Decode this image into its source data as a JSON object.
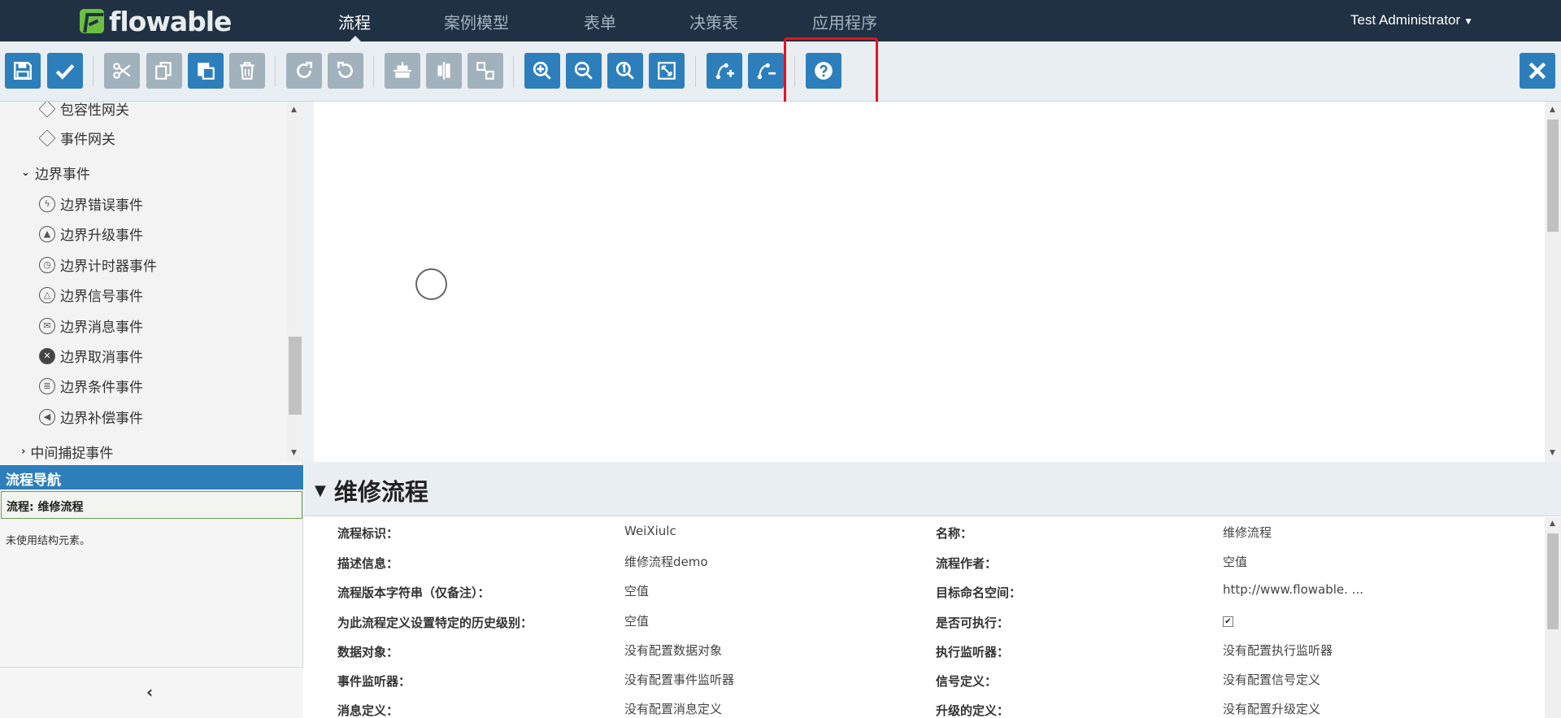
{
  "brand": {
    "logo_text": "flowable"
  },
  "nav": {
    "tabs": [
      {
        "label": "流程",
        "active": true
      },
      {
        "label": "案例模型",
        "active": false
      },
      {
        "label": "表单",
        "active": false
      },
      {
        "label": "决策表",
        "active": false
      },
      {
        "label": "应用程序",
        "active": false
      }
    ],
    "user": "Test Administrator"
  },
  "toolbar": {
    "buttons": [
      {
        "name": "save",
        "icon": "floppy-disk-icon",
        "enabled": true
      },
      {
        "name": "validate",
        "icon": "checkmark-icon",
        "enabled": true
      },
      {
        "name": "cut",
        "icon": "scissors-icon",
        "enabled": false
      },
      {
        "name": "copy",
        "icon": "copy-icon",
        "enabled": false
      },
      {
        "name": "paste",
        "icon": "paste-icon",
        "enabled": true
      },
      {
        "name": "delete",
        "icon": "trash-icon",
        "enabled": false
      },
      {
        "name": "redo",
        "icon": "redo-icon",
        "enabled": false
      },
      {
        "name": "undo",
        "icon": "undo-icon",
        "enabled": false
      },
      {
        "name": "align-horizontal",
        "icon": "align-horizontal-icon",
        "enabled": false
      },
      {
        "name": "align-vertical",
        "icon": "align-vertical-icon",
        "enabled": false
      },
      {
        "name": "same-size",
        "icon": "same-size-icon",
        "enabled": false
      },
      {
        "name": "zoom-in",
        "icon": "zoom-in-icon",
        "enabled": true
      },
      {
        "name": "zoom-out",
        "icon": "zoom-out-icon",
        "enabled": true
      },
      {
        "name": "zoom-actual",
        "icon": "zoom-actual-icon",
        "enabled": true
      },
      {
        "name": "zoom-fit",
        "icon": "zoom-fit-icon",
        "enabled": true
      },
      {
        "name": "add-bendpoint",
        "icon": "bendpoint-add-icon",
        "enabled": true
      },
      {
        "name": "remove-bendpoint",
        "icon": "bendpoint-remove-icon",
        "enabled": true
      },
      {
        "name": "help",
        "icon": "help-icon",
        "enabled": true
      },
      {
        "name": "close",
        "icon": "close-icon",
        "enabled": true
      }
    ]
  },
  "palette": {
    "items": [
      {
        "label": "包容性网关",
        "icon": "gateway-icon",
        "kind": "item"
      },
      {
        "label": "事件网关",
        "icon": "gateway-icon",
        "kind": "item"
      },
      {
        "label": "边界事件",
        "icon": "chevron-down-icon",
        "kind": "group"
      },
      {
        "label": "边界错误事件",
        "icon": "error-event-icon",
        "kind": "item"
      },
      {
        "label": "边界升级事件",
        "icon": "escalation-event-icon",
        "kind": "item"
      },
      {
        "label": "边界计时器事件",
        "icon": "timer-event-icon",
        "kind": "item"
      },
      {
        "label": "边界信号事件",
        "icon": "signal-event-icon",
        "kind": "item"
      },
      {
        "label": "边界消息事件",
        "icon": "message-event-icon",
        "kind": "item"
      },
      {
        "label": "边界取消事件",
        "icon": "cancel-event-icon",
        "kind": "item"
      },
      {
        "label": "边界条件事件",
        "icon": "conditional-event-icon",
        "kind": "item"
      },
      {
        "label": "边界补偿事件",
        "icon": "compensation-event-icon",
        "kind": "item"
      },
      {
        "label": "中间捕捉事件",
        "icon": "chevron-right-icon",
        "kind": "group"
      }
    ]
  },
  "navigator": {
    "title": "流程导航",
    "selected": "流程: 维修流程",
    "empty_text": "未使用结构元素。"
  },
  "properties": {
    "title": "维修流程",
    "rows": [
      {
        "l1": "流程标识：",
        "v1": "WeiXiulc",
        "l2": "名称：",
        "v2": "维修流程"
      },
      {
        "l1": "描述信息：",
        "v1": "维修流程demo",
        "l2": "流程作者：",
        "v2": "空值"
      },
      {
        "l1": "流程版本字符串（仅备注）：",
        "v1": "空值",
        "l2": "目标命名空间：",
        "v2": "http://www.flowable. ..."
      },
      {
        "l1": "为此流程定义设置特定的历史级别：",
        "v1": "空值",
        "l2": "是否可执行：",
        "v2": "✔"
      },
      {
        "l1": "数据对象：",
        "v1": "没有配置数据对象",
        "l2": "执行监听器：",
        "v2": "没有配置执行监听器"
      },
      {
        "l1": "事件监听器：",
        "v1": "没有配置事件监听器",
        "l2": "信号定义：",
        "v2": "没有配置信号定义"
      },
      {
        "l1": "消息定义：",
        "v1": "没有配置消息定义",
        "l2": "升级的定义：",
        "v2": "没有配置升级定义"
      }
    ]
  },
  "colors": {
    "navbar": "#1f3143",
    "primary": "#2d7fbc",
    "disabled": "#a2b2bc",
    "highlight": "#e8121f"
  }
}
